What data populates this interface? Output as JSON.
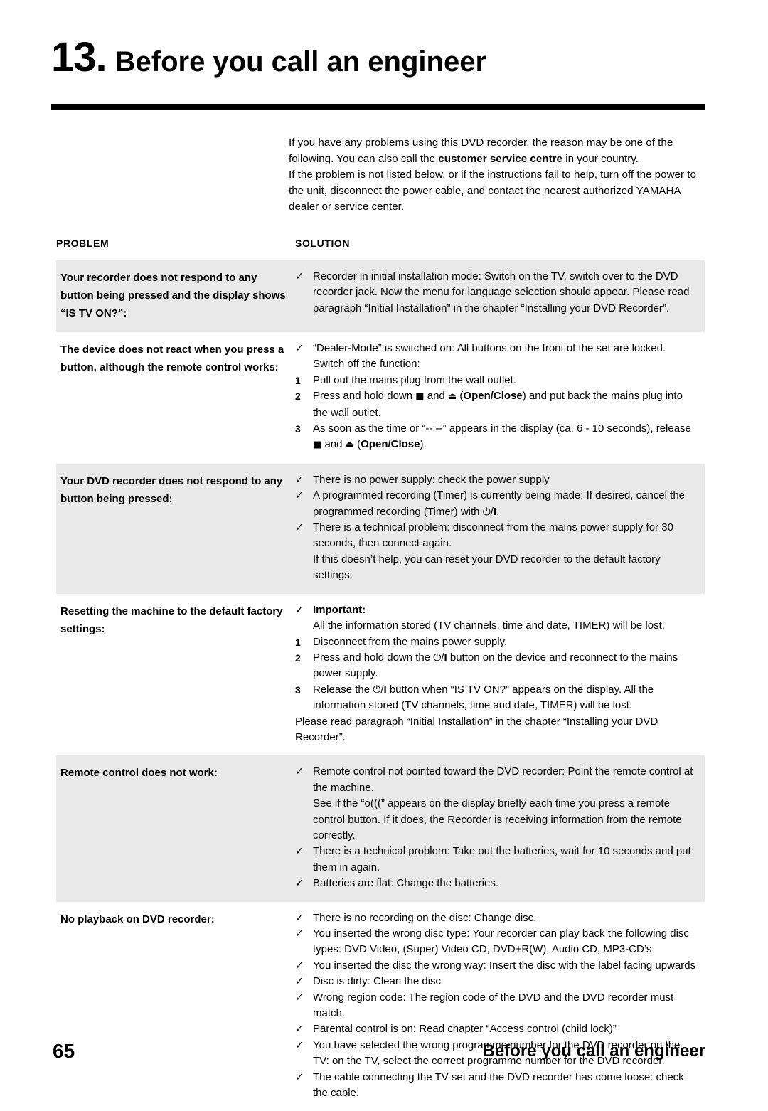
{
  "heading": {
    "number": "13.",
    "title": "Before you call an engineer"
  },
  "intro": {
    "line1_a": "If you have any problems using this DVD recorder, the reason may be one of the following. You can also call the ",
    "line1_b": "customer service centre",
    "line1_c": " in your country.",
    "line2": "If the problem is not listed below, or if the instructions fail to help, turn off the power to the unit, disconnect the power cable, and contact the nearest authorized YAMAHA dealer or service center."
  },
  "table": {
    "header": {
      "problem": "PROBLEM",
      "solution": "SOLUTION"
    },
    "check_marker": "✓",
    "rows": [
      {
        "shaded": true,
        "problem": "Your recorder does not respond to any button being pressed and the display shows “IS TV ON?”:",
        "items": [
          {
            "marker": "check",
            "text": "Recorder in initial installation mode: Switch on the TV, switch over to the DVD recorder jack. Now the menu for language selection should appear. Please read paragraph “Initial Installation” in the chapter “Installing your DVD Recorder”."
          }
        ]
      },
      {
        "shaded": false,
        "problem": "The device does not react when you press a button, although the remote control works:",
        "items": [
          {
            "marker": "check",
            "text": "“Dealer-Mode” is switched on: All buttons on the front of the set are locked."
          },
          {
            "marker": "none",
            "text": "Switch off the function:"
          },
          {
            "marker": "1",
            "text": "Pull out the mains plug from the wall outlet."
          },
          {
            "marker": "2",
            "text_html": "Press and hold down <span class=\"sym\">■</span> and <span class=\"sym\">⏏</span> (<b>Open/Close</b>) and put back the mains plug into the wall outlet."
          },
          {
            "marker": "3",
            "text_html": "As soon as the time or “--:--” appears in the display (ca. 6 - 10 seconds), release <span class=\"sym\">■</span> and <span class=\"sym\">⏏</span> (<b>Open/Close</b>)."
          }
        ]
      },
      {
        "shaded": true,
        "problem": "Your DVD recorder does not respond to any button being pressed:",
        "items": [
          {
            "marker": "check",
            "text": "There is no power supply: check the power supply"
          },
          {
            "marker": "check",
            "text_html": "A programmed recording (Timer) is currently being made: If desired, cancel the programmed recording (Timer) with <span class=\"sym-power\">⏻</span>/<b>I</b>."
          },
          {
            "marker": "check",
            "text": "There is a technical problem: disconnect from the mains power supply for 30 seconds, then connect again."
          },
          {
            "marker": "none",
            "text": "If this doesn’t help, you can reset your DVD recorder to the default factory settings."
          }
        ]
      },
      {
        "shaded": false,
        "problem": "Resetting the machine to the default factory settings:",
        "items": [
          {
            "marker": "check",
            "text_html": "<b>Important:</b>"
          },
          {
            "marker": "none",
            "text": "All the information stored (TV channels, time and date, TIMER) will be lost."
          },
          {
            "marker": "1",
            "text": "Disconnect from the mains power supply."
          },
          {
            "marker": "2",
            "text_html": "Press and hold down the <span class=\"sym-power\">⏻</span>/<b>I</b> button on the device and reconnect to the mains power supply."
          },
          {
            "marker": "3",
            "text_html": "Release the <span class=\"sym-power\">⏻</span>/<b>I</b> button when “IS TV ON?” appears on the display. All the information stored (TV channels, time and date, TIMER) will be lost."
          },
          {
            "marker": "flush",
            "text": "Please read paragraph “Initial Installation” in the chapter “Installing your DVD Recorder”."
          }
        ]
      },
      {
        "shaded": true,
        "problem": "Remote control does not work:",
        "items": [
          {
            "marker": "check",
            "text": "Remote control not pointed toward the DVD recorder: Point the remote control at the machine."
          },
          {
            "marker": "none",
            "text": "See if the “o(((” appears on the display briefly each time you press a remote control button. If it does, the Recorder is receiving information from the remote correctly."
          },
          {
            "marker": "check",
            "text": "There is a technical problem: Take out the batteries, wait for 10 seconds and put them in again."
          },
          {
            "marker": "check",
            "text": "Batteries are flat: Change the batteries."
          }
        ]
      },
      {
        "shaded": false,
        "problem": "No playback on DVD recorder:",
        "items": [
          {
            "marker": "check",
            "text": "There is no recording on the disc: Change disc."
          },
          {
            "marker": "check",
            "text": "You inserted the wrong disc type: Your recorder can play back the following disc types: DVD Video, (Super) Video CD, DVD+R(W), Audio CD, MP3-CD’s"
          },
          {
            "marker": "check",
            "text": "You inserted the disc the wrong way: Insert the disc with the label facing upwards"
          },
          {
            "marker": "check",
            "text": "Disc is dirty: Clean the disc"
          },
          {
            "marker": "check",
            "text": "Wrong region code: The region code of the DVD and the DVD recorder must match."
          },
          {
            "marker": "check",
            "text": "Parental control is on: Read chapter “Access control (child lock)”"
          },
          {
            "marker": "check",
            "text": "You have selected the wrong programme number for the DVD recorder on the TV: on the TV, select the correct programme number for the DVD recorder."
          },
          {
            "marker": "check",
            "text": "The cable connecting the TV set and the DVD recorder has come loose: check the cable."
          }
        ]
      }
    ]
  },
  "footer": {
    "page_number": "65",
    "title": "Before you call an engineer"
  }
}
